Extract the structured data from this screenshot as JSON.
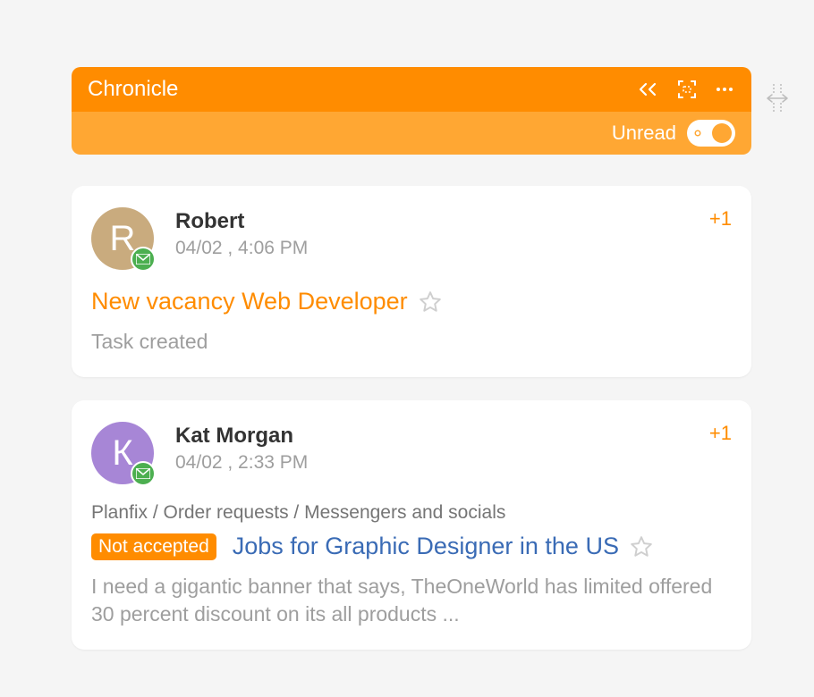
{
  "header": {
    "title": "Chronicle",
    "unread_label": "Unread"
  },
  "resize_icon": "drag-resize",
  "cards": [
    {
      "avatar_letter": "R",
      "avatar_color": "#c9ab7e",
      "author": "Robert",
      "timestamp": "04/02 , 4:06 PM",
      "count": "+1",
      "title": "New vacancy Web Developer",
      "title_color": "orange",
      "body": "Task created"
    },
    {
      "avatar_letter": "К",
      "avatar_color": "#a786d6",
      "author": "Kat Morgan",
      "timestamp": "04/02 , 2:33 PM",
      "count": "+1",
      "breadcrumb": "Planfix / Order requests / Messengers and socials",
      "badge": "Not accepted",
      "title": "Jobs for Graphic Designer in the US",
      "title_color": "blue",
      "body": "I need a gigantic banner that says, TheOneWorld has limited offered 30 percent discount on its all products ..."
    }
  ]
}
